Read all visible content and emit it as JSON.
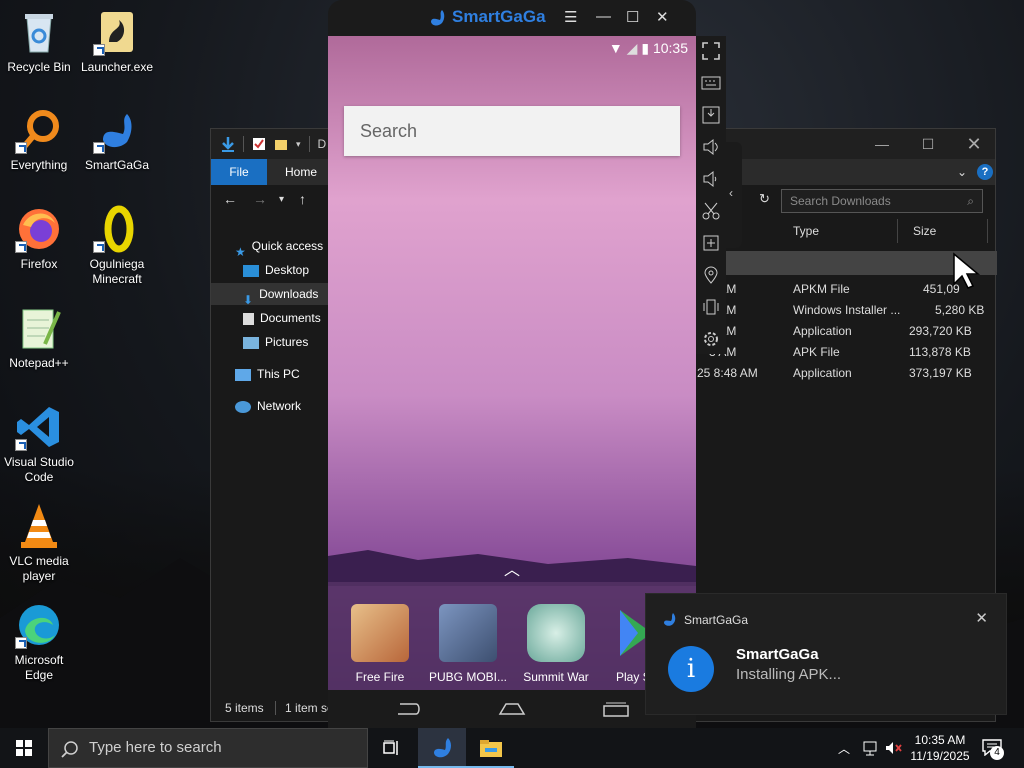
{
  "desktop": {
    "icons": [
      {
        "label": "Recycle Bin",
        "icon": "recycle-bin-icon"
      },
      {
        "label": "Launcher.exe",
        "icon": "launcher-icon"
      },
      {
        "label": "Everything",
        "icon": "everything-icon"
      },
      {
        "label": "SmartGaGa",
        "icon": "smartgaga-icon"
      },
      {
        "label": "Firefox",
        "icon": "firefox-icon"
      },
      {
        "label": "Ogulniega Minecraft",
        "icon": "minecraft-launcher-icon"
      },
      {
        "label": "Notepad++",
        "icon": "notepadpp-icon"
      },
      {
        "label": "Visual Studio Code",
        "icon": "vscode-icon"
      },
      {
        "label": "VLC media player",
        "icon": "vlc-icon"
      },
      {
        "label": "Microsoft Edge",
        "icon": "edge-icon"
      }
    ]
  },
  "explorer": {
    "title_fragment": "D",
    "ribbon": {
      "file": "File",
      "home": "Home"
    },
    "search_placeholder": "Search Downloads",
    "nav": {
      "quick_access": "Quick access",
      "desktop": "Desktop",
      "downloads": "Downloads",
      "documents": "Documents",
      "pictures": "Pictures",
      "this_pc": "This PC",
      "network": "Network"
    },
    "columns": {
      "type": "Type",
      "size": "Size"
    },
    "rows": [
      {
        "time": "4 AM",
        "type": "APKM File",
        "size": "451,09"
      },
      {
        "time": "1 AM",
        "type": "Windows Installer ...",
        "size": "5,280 KB"
      },
      {
        "time": "5 AM",
        "type": "Application",
        "size": "293,720 KB"
      },
      {
        "time": "3 AM",
        "type": "APK File",
        "size": "113,878 KB"
      },
      {
        "time": "25 8:48 AM",
        "type": "Application",
        "size": "373,197 KB"
      }
    ],
    "status": {
      "items": "5 items",
      "selected": "1 item se"
    }
  },
  "emulator": {
    "brand": "SmartGaGa",
    "time": "10:35",
    "search_placeholder": "Search",
    "apps": [
      {
        "label": "Free Fire",
        "color": "#d9a070"
      },
      {
        "label": "PUBG MOBI...",
        "color": "#6a7fa8"
      },
      {
        "label": "Summit War",
        "color": "#8fc7b8"
      },
      {
        "label": "Play S",
        "color": "#34a853"
      }
    ]
  },
  "toast": {
    "app_name": "SmartGaGa",
    "title": "SmartGaGa",
    "message": "Installing APK..."
  },
  "taskbar": {
    "search_placeholder": "Type here to search",
    "time": "10:35 AM",
    "date": "11/19/2025",
    "notification_count": "4"
  },
  "colors": {
    "accent": "#1a6fc2",
    "smartgaga_brand": "#2f7fe0",
    "info_blue": "#1a7be0"
  }
}
